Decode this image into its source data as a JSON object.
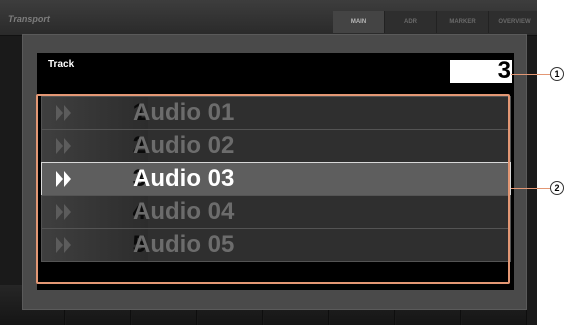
{
  "app": {
    "title": "Transport"
  },
  "tabs": [
    {
      "label": "MAIN",
      "active": true
    },
    {
      "label": "ADR",
      "active": false
    },
    {
      "label": "MARKER",
      "active": false
    },
    {
      "label": "OVERVIEW",
      "active": false
    }
  ],
  "dialog": {
    "track_label": "Track",
    "track_number": "3",
    "tracks": [
      {
        "num": "1",
        "name": "Audio 01",
        "selected": false
      },
      {
        "num": "2",
        "name": "Audio 02",
        "selected": false
      },
      {
        "num": "3",
        "name": "Audio 03",
        "selected": true
      },
      {
        "num": "4",
        "name": "Audio 04",
        "selected": false
      },
      {
        "num": "5",
        "name": "Audio 05",
        "selected": false
      }
    ]
  },
  "callouts": [
    {
      "label": "1"
    },
    {
      "label": "2"
    }
  ],
  "colors": {
    "callout": "#e39774",
    "selected_row": "#5e5e5e",
    "row_bg": "#2f2f2f"
  }
}
